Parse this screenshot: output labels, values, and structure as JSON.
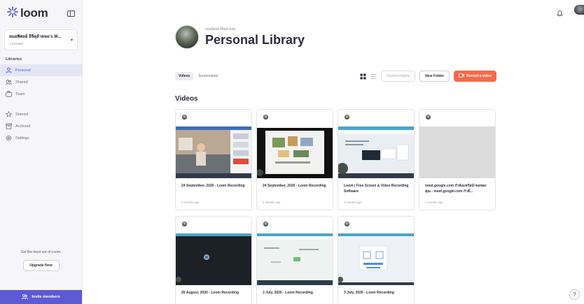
{
  "brand": {
    "name": "loom",
    "accent": "#5d5ad6",
    "record_color": "#f46a4e"
  },
  "workspace": {
    "name": "หมอพิศลย์ อิจิตุล้าดหอ's W...",
    "members": "1 member"
  },
  "sidebar": {
    "libraries_label": "Libraries",
    "library_items": [
      {
        "label": "Personal",
        "icon": "person-icon",
        "active": true
      },
      {
        "label": "Shared",
        "icon": "people-icon",
        "active": false
      },
      {
        "label": "Team",
        "icon": "team-icon",
        "active": false
      }
    ],
    "other_items": [
      {
        "label": "Starred",
        "icon": "star-icon"
      },
      {
        "label": "Archived",
        "icon": "archive-icon"
      },
      {
        "label": "Settings",
        "icon": "gear-icon"
      }
    ],
    "upsell_text": "Get the most out of Loom.",
    "upgrade_label": "Upgrade Now",
    "invite_label": "Invite members"
  },
  "header": {
    "owner": "หมอพิศลย์ อิจิตุล้าดหอ",
    "title": "Personal Library"
  },
  "toolbar": {
    "tabs": [
      {
        "label": "Videos",
        "active": true
      },
      {
        "label": "Screenshots",
        "active": false
      }
    ],
    "export_label": "Export insights",
    "new_folder_label": "New Folder",
    "record_label": "Record a video"
  },
  "section_title": "Videos",
  "videos": [
    {
      "title": "24 September, 2020 - Loom Recording",
      "meta": "2 months ago",
      "thumb": "people"
    },
    {
      "title": "24 September, 2020 - Loom Recording",
      "meta": "2 months ago",
      "thumb": "slides"
    },
    {
      "title": "Loom | Free Screen & Video Recording Software",
      "meta": "2 months ago",
      "thumb": "screen"
    },
    {
      "title": "meet.google.com กำลังแชร์หน้าจอของคุณ - meet.google.com กำลั...",
      "meta": "2 months ago",
      "thumb": "blank"
    },
    {
      "title": "26 August, 2020 - Loom Recording",
      "meta": "",
      "thumb": "dark"
    },
    {
      "title": "3 July, 2020 - Loom Recording",
      "meta": "",
      "thumb": "screen2"
    },
    {
      "title": "3 July, 2020 - Loom Recording",
      "meta": "",
      "thumb": "dialog"
    }
  ],
  "help_label": "?"
}
